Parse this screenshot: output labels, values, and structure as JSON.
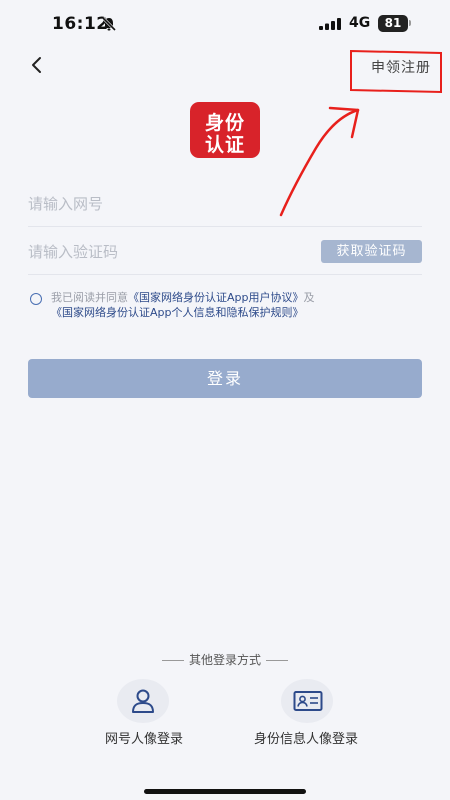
{
  "status_bar": {
    "time": "16:12",
    "network": "4G",
    "battery": "81"
  },
  "nav": {
    "register_label": "申领注册"
  },
  "logo": {
    "line1": "身份",
    "line2": "认证"
  },
  "form": {
    "account_placeholder": "请输入网号",
    "code_placeholder": "请输入验证码",
    "get_code_label": "获取验证码"
  },
  "agreement": {
    "prefix": "我已阅读并同意",
    "user_agreement": "《国家网络身份认证App用户协议》",
    "and": "及",
    "privacy_rules": "《国家网络身份认证App个人信息和隐私保护规则》"
  },
  "login_label": "登录",
  "other_login": {
    "title": "其他登录方式",
    "options": [
      {
        "label": "网号人像登录",
        "icon": "person-icon"
      },
      {
        "label": "身份信息人像登录",
        "icon": "id-card-icon"
      }
    ]
  },
  "colors": {
    "logo_red": "#d8232a",
    "button_blue": "#97abcd",
    "link_blue": "#2d4a8a",
    "annotation_red": "#e8201c"
  }
}
